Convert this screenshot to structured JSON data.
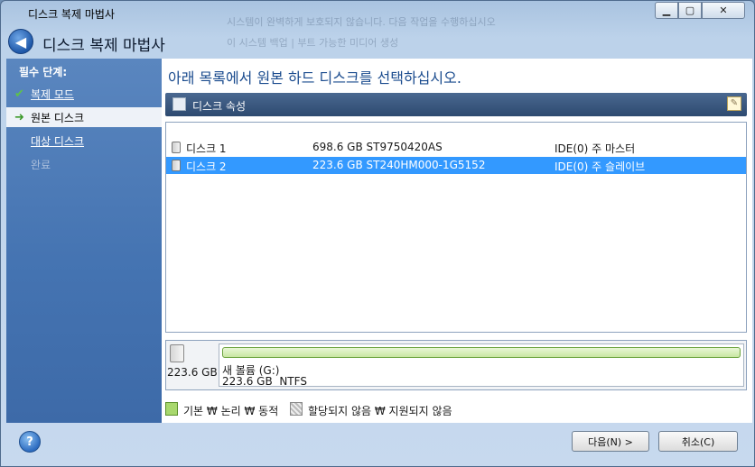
{
  "window": {
    "title": "디스크 복제 마법사"
  },
  "background_hint": {
    "line1": "시스템이 완벽하게 보호되지 않습니다. 다음 작업을 수행하십시오",
    "line2": "이 시스템 백업 | 부트 가능한 미디어 생성"
  },
  "header": {
    "title": "디스크 복제 마법사"
  },
  "sidebar": {
    "heading": "필수 단계:",
    "items": [
      {
        "label": "복제 모드",
        "state": "done"
      },
      {
        "label": "원본 디스크",
        "state": "current"
      },
      {
        "label": "대상 디스크",
        "state": "link"
      },
      {
        "label": "완료",
        "state": "disabled"
      }
    ]
  },
  "main": {
    "title": "아래 목록에서 원본 하드 디스크를 선택하십시오.",
    "panel_label": "디스크 속성",
    "disks": [
      {
        "name": "디스크 1",
        "model": "698.6 GB ST9750420AS",
        "interface": "IDE(0) 주 마스터",
        "selected": false
      },
      {
        "name": "디스크 2",
        "model": "223.6 GB ST240HM000-1G5152",
        "interface": "IDE(0) 주 슬레이브",
        "selected": true
      }
    ],
    "volume": {
      "disk_size": "223.6 GB",
      "name": "새 볼륨 (G:)",
      "info": "223.6 GB  NTFS"
    },
    "legend": {
      "primary": "기본 ₩ 논리 ₩ 동적",
      "unallocated": "할당되지 않음 ₩ 지원되지 않음"
    }
  },
  "footer": {
    "next_label": "다음(N) >",
    "cancel_label": "취소(C)"
  },
  "colors": {
    "selection": "#3399ff",
    "sidebar": "#4574b2",
    "title_text": "#1a4b8e",
    "volume_bar": "#c8e6a2"
  }
}
